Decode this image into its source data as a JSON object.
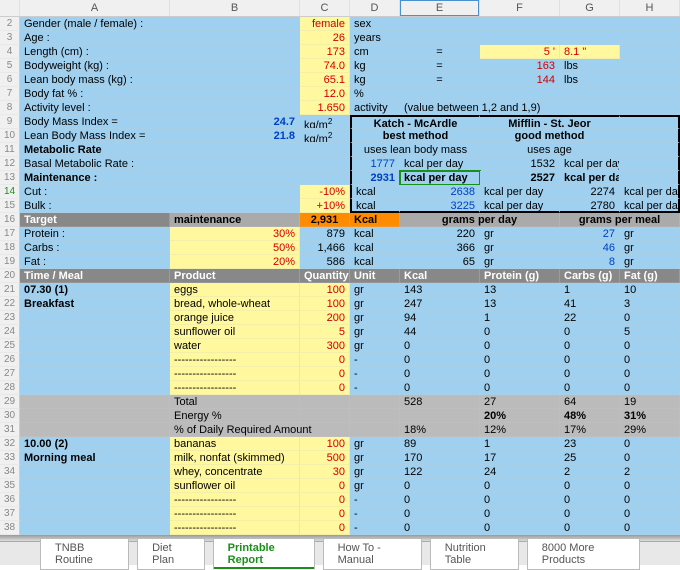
{
  "columns": [
    "",
    "A",
    "B",
    "C",
    "D",
    "E",
    "F",
    "G",
    "H"
  ],
  "inputs": {
    "gender": {
      "label": "Gender (male / female) :",
      "value": "female",
      "unit": "sex"
    },
    "age": {
      "label": "Age :",
      "value": "26",
      "unit": "years"
    },
    "length": {
      "label": "Length (cm) :",
      "value": "173",
      "unit": "cm",
      "eq": "=",
      "imp": "5 '",
      "imp2": "8.1 \""
    },
    "bw": {
      "label": "Bodyweight (kg) :",
      "value": "74.0",
      "unit": "kg",
      "eq": "=",
      "imp": "163",
      "impu": "lbs"
    },
    "lbm": {
      "label": "Lean body mass (kg) :",
      "value": "65.1",
      "unit": "kg",
      "eq": "=",
      "imp": "144",
      "impu": "lbs"
    },
    "bf": {
      "label": "Body fat % :",
      "value": "12.0",
      "unit": "%"
    },
    "act": {
      "label": "Activity level :",
      "value": "1.650",
      "unit": "activity",
      "note": "(value between 1,2 and 1,9)"
    }
  },
  "bmi": {
    "label": "Body Mass Index =",
    "value": "24.7",
    "unit": "kg/m",
    "sup": "2"
  },
  "lbmi": {
    "label": "Lean Body Mass Index =",
    "value": "21.8",
    "unit": "kg/m",
    "sup": "2"
  },
  "methods": {
    "katch": {
      "name": "Katch - McArdle",
      "sub": "best method",
      "uses": "uses lean body mass"
    },
    "mifflin": {
      "name": "Mifflin - St. Jeor",
      "sub": "good method",
      "uses": "uses age"
    }
  },
  "metab": {
    "hdr": "Metabolic Rate",
    "bmr": {
      "label": "Basal Metabolic Rate :",
      "k": "1777",
      "m": "1532",
      "u": "kcal per day"
    },
    "maint": {
      "label": "Maintenance :",
      "k": "2931",
      "m": "2527",
      "u": "kcal per day"
    },
    "cut": {
      "label": "Cut :",
      "pct": "-10%",
      "pu": "kcal",
      "k": "2638",
      "m": "2274",
      "u": "kcal per day"
    },
    "bulk": {
      "label": "Bulk :",
      "pct": "+10%",
      "pu": "kcal",
      "k": "3225",
      "m": "2780",
      "u": "kcal per day"
    }
  },
  "target": {
    "hdr": "Target",
    "sub": "maintenance",
    "kcal": "2,931",
    "ku": "Kcal",
    "gpd": "grams per day",
    "gpm": "grams per meal",
    "protein": {
      "label": "Protein :",
      "pct": "30%",
      "kcal": "879",
      "u": "kcal",
      "gpd": "220",
      "gpdu": "gr",
      "gpm": "27",
      "gpmu": "gr"
    },
    "carbs": {
      "label": "Carbs :",
      "pct": "50%",
      "kcal": "1,466",
      "u": "kcal",
      "gpd": "366",
      "gpdu": "gr",
      "gpm": "46",
      "gpmu": "gr"
    },
    "fat": {
      "label": "Fat :",
      "pct": "20%",
      "kcal": "586",
      "u": "kcal",
      "gpd": "65",
      "gpdu": "gr",
      "gpm": "8",
      "gpmu": "gr"
    }
  },
  "foodhdr": {
    "time": "Time / Meal",
    "prod": "Product",
    "qty": "Quantity",
    "unit": "Unit",
    "kcal": "Kcal",
    "prot": "Protein (g)",
    "carb": "Carbs (g)",
    "fat": "Fat (g)"
  },
  "meals": [
    {
      "time": "07.30 (1)",
      "name": "Breakfast",
      "items": [
        {
          "p": "eggs",
          "q": "100",
          "u": "gr",
          "k": "143",
          "pr": "13",
          "c": "1",
          "f": "10"
        },
        {
          "p": "bread, whole-wheat",
          "q": "100",
          "u": "gr",
          "k": "247",
          "pr": "13",
          "c": "41",
          "f": "3"
        },
        {
          "p": "orange juice",
          "q": "200",
          "u": "gr",
          "k": "94",
          "pr": "1",
          "c": "22",
          "f": "0"
        },
        {
          "p": "sunflower oil",
          "q": "5",
          "u": "gr",
          "k": "44",
          "pr": "0",
          "c": "0",
          "f": "5"
        },
        {
          "p": "water",
          "q": "300",
          "u": "gr",
          "k": "0",
          "pr": "0",
          "c": "0",
          "f": "0"
        },
        {
          "p": "-----------------",
          "q": "0",
          "u": "-",
          "k": "0",
          "pr": "0",
          "c": "0",
          "f": "0"
        },
        {
          "p": "-----------------",
          "q": "0",
          "u": "-",
          "k": "0",
          "pr": "0",
          "c": "0",
          "f": "0"
        },
        {
          "p": "-----------------",
          "q": "0",
          "u": "-",
          "k": "0",
          "pr": "0",
          "c": "0",
          "f": "0"
        }
      ],
      "total": {
        "lbl": "Total",
        "k": "528",
        "pr": "27",
        "c": "64",
        "f": "19"
      },
      "energy": {
        "lbl": "Energy %",
        "pr": "20%",
        "c": "48%",
        "f": "31%"
      },
      "daily": {
        "lbl": "% of Daily Required Amount",
        "k": "18%",
        "pr": "12%",
        "c": "17%",
        "f": "29%"
      }
    },
    {
      "time": "10.00 (2)",
      "name": "Morning meal",
      "items": [
        {
          "p": "bananas",
          "q": "100",
          "u": "gr",
          "k": "89",
          "pr": "1",
          "c": "23",
          "f": "0"
        },
        {
          "p": "milk, nonfat (skimmed)",
          "q": "500",
          "u": "gr",
          "k": "170",
          "pr": "17",
          "c": "25",
          "f": "0"
        },
        {
          "p": "whey, concentrate",
          "q": "30",
          "u": "gr",
          "k": "122",
          "pr": "24",
          "c": "2",
          "f": "2"
        },
        {
          "p": "sunflower oil",
          "q": "0",
          "u": "gr",
          "k": "0",
          "pr": "0",
          "c": "0",
          "f": "0"
        },
        {
          "p": "-----------------",
          "q": "0",
          "u": "-",
          "k": "0",
          "pr": "0",
          "c": "0",
          "f": "0"
        },
        {
          "p": "-----------------",
          "q": "0",
          "u": "-",
          "k": "0",
          "pr": "0",
          "c": "0",
          "f": "0"
        },
        {
          "p": "-----------------",
          "q": "0",
          "u": "-",
          "k": "0",
          "pr": "0",
          "c": "0",
          "f": "0"
        }
      ]
    }
  ],
  "tabs": [
    "TNBB Routine",
    "Diet Plan",
    "Printable Report",
    "How To - Manual",
    "Nutrition Table",
    "8000 More Products"
  ],
  "activeTab": 2
}
